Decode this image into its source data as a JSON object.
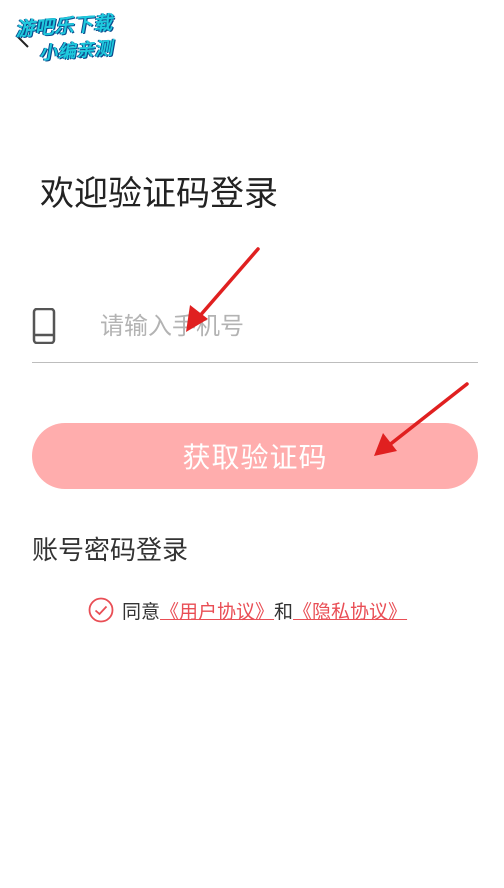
{
  "watermark": {
    "line1": "游吧乐下载",
    "line2": "小编亲测"
  },
  "header": {
    "back_icon": "chevron-left-icon"
  },
  "main": {
    "title": "欢迎验证码登录",
    "phone_icon": "phone-icon",
    "phone_placeholder": "请输入手机号",
    "phone_value": "",
    "get_code_label": "获取验证码",
    "account_login_label": "账号密码登录",
    "agreement": {
      "check_icon": "check-circle-icon",
      "agree_text": "同意",
      "user_agreement": "《用户协议》",
      "and_text": "和",
      "privacy_policy": "《隐私协议》"
    }
  },
  "colors": {
    "button_bg": "#ffadad",
    "link": "#e94e55",
    "annotation_arrow": "#e02020"
  }
}
